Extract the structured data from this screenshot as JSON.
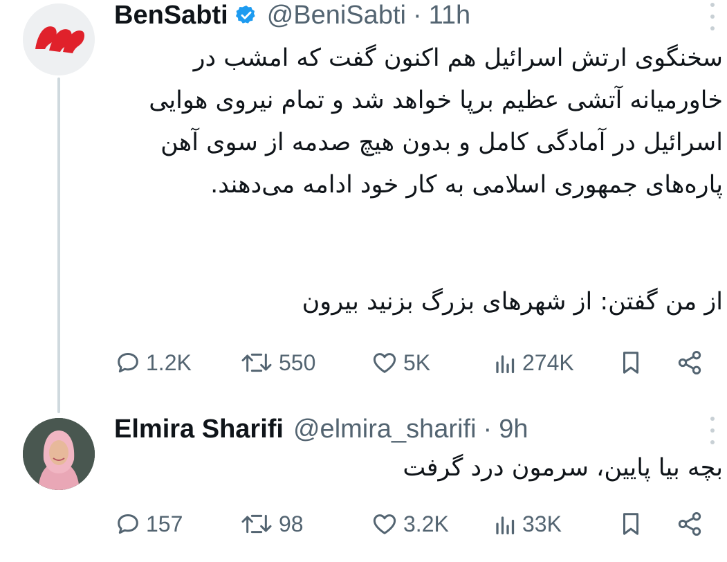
{
  "tweets": [
    {
      "author_name": "BenSabti",
      "handle": "@BeniSabti",
      "time": "11h",
      "verified": true,
      "text_paragraph_1": "سخنگوی ارتش اسرائیل هم اکنون گفت که امشب در خاورمیانه آتشی عظیم برپا خواهد شد و تمام نیروی هوایی اسرائیل در آمادگی کامل و بدون هیچ صدمه از سوی آهن پاره‌های جمهوری اسلامی به کار خود ادامه می‌دهند.",
      "text_paragraph_2": "از من گفتن: از شهرهای بزرگ بزنید بیرون",
      "replies": "1.2K",
      "retweets": "550",
      "likes": "5K",
      "views": "274K"
    },
    {
      "author_name": "Elmira Sharifi",
      "handle": "@elmira_sharifi",
      "time": "9h",
      "text": "بچه بیا پایین، سرمون درد گرفت",
      "replies": "157",
      "retweets": "98",
      "likes": "3.2K",
      "views": "33K"
    }
  ],
  "colors": {
    "text": "#0f1419",
    "secondary": "#536471",
    "verified": "#1d9bf0",
    "logo_red": "#e0212b",
    "thread_line": "#cfd9de"
  },
  "icons": [
    "reply-icon",
    "retweet-icon",
    "like-icon",
    "views-icon",
    "bookmark-icon",
    "share-icon",
    "more-icon",
    "verified-badge-icon"
  ]
}
